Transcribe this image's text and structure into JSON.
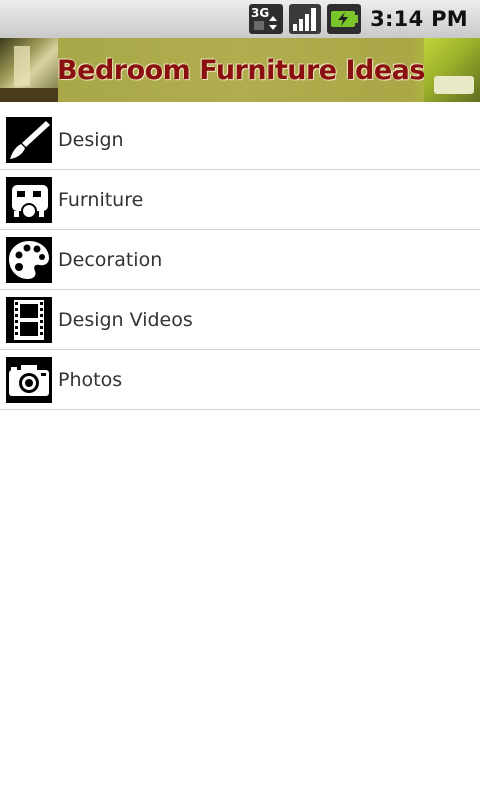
{
  "status_bar": {
    "network_label": "3G",
    "time": "3:14 PM",
    "icons": [
      "3g-data-icon",
      "signal-icon",
      "battery-charging-icon"
    ]
  },
  "banner": {
    "title": "Bedroom Furniture Ideas"
  },
  "menu": {
    "items": [
      {
        "label": "Design",
        "icon": "paintbrush-icon"
      },
      {
        "label": "Furniture",
        "icon": "furniture-icon"
      },
      {
        "label": "Decoration",
        "icon": "palette-icon"
      },
      {
        "label": "Design Videos",
        "icon": "film-strip-icon"
      },
      {
        "label": "Photos",
        "icon": "camera-icon"
      }
    ]
  },
  "colors": {
    "banner_title": "#8a1010",
    "banner_bg": "#b0ad4e",
    "divider": "#cfcfcf",
    "label_text": "#333333"
  }
}
